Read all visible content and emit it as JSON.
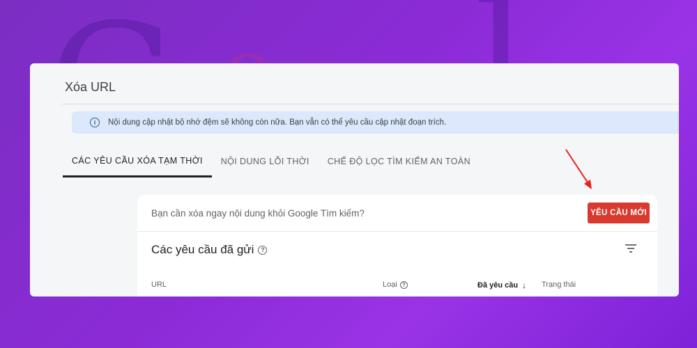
{
  "page": {
    "title": "Xóa URL"
  },
  "banner": {
    "text": "Nội dung cập nhật bộ nhớ đệm sẽ không còn nữa. Bạn vẫn có thể yêu cầu cập nhật đoạn trích."
  },
  "tabs": [
    {
      "label": "CÁC YÊU CẦU XÓA TẠM THỜI",
      "active": true
    },
    {
      "label": "NỘI DUNG LỖI THỜI",
      "active": false
    },
    {
      "label": "CHẾ ĐỘ LỌC TÌM KIẾM AN TOÀN",
      "active": false
    }
  ],
  "card": {
    "question": "Bạn cần xóa ngay nội dung khỏi Google Tìm kiếm?",
    "new_request_label": "YÊU CẦU MỚI",
    "sent_title": "Các yêu cầu đã gửi"
  },
  "table": {
    "columns": {
      "url": "URL",
      "type": "Loại",
      "requested": "Đã yêu cầu",
      "status": "Trạng thái"
    }
  },
  "colors": {
    "accent_button": "#d93a2f",
    "annotation_arrow": "#e8221b",
    "banner_bg": "#dce8fb"
  },
  "icons": {
    "info": "info-icon",
    "help": "help-icon",
    "filter": "filter-icon",
    "sort": "arrow-down-icon"
  }
}
